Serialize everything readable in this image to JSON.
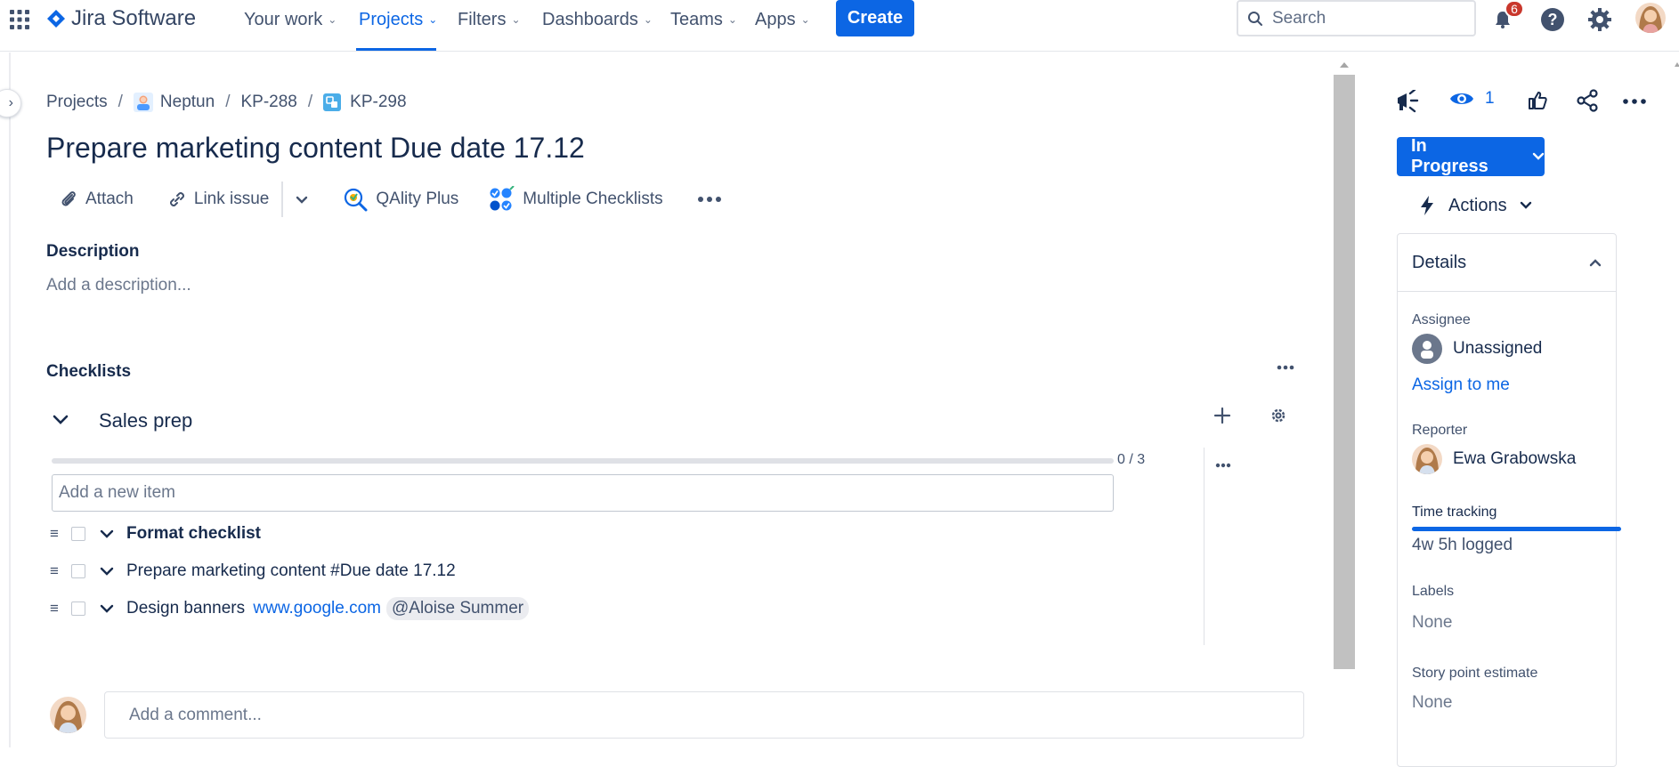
{
  "app": {
    "name": "Jira Software"
  },
  "nav": {
    "your_work": "Your work",
    "projects": "Projects",
    "filters": "Filters",
    "dashboards": "Dashboards",
    "teams": "Teams",
    "apps": "Apps",
    "create": "Create"
  },
  "search": {
    "placeholder": "Search"
  },
  "notifications": {
    "count": "6"
  },
  "breadcrumbs": [
    "Projects",
    "Neptun",
    "KP-288",
    "KP-298"
  ],
  "issue": {
    "title": "Prepare marketing content Due date 17.12"
  },
  "toolbar": {
    "attach": "Attach",
    "link_issue": "Link issue",
    "qality": "QAlity Plus",
    "checklists": "Multiple Checklists"
  },
  "description": {
    "label": "Description",
    "placeholder": "Add a description..."
  },
  "checklists": {
    "label": "Checklists",
    "group": "Sales prep",
    "progress_text": "0 / 3",
    "progress_value": 0,
    "new_item_placeholder": "Add a new item",
    "items": [
      {
        "text": "Format checklist",
        "bold": true
      },
      {
        "text": "Prepare marketing content #Due date 17.12"
      },
      {
        "text": "Design banners ",
        "link": "www.google.com",
        "mention": "@Aloise Summer"
      }
    ]
  },
  "comment": {
    "placeholder": "Add a comment..."
  },
  "side": {
    "watchers": "1",
    "status": "In Progress",
    "actions": "Actions",
    "details_title": "Details",
    "assignee_label": "Assignee",
    "assignee": "Unassigned",
    "assign_to_me": "Assign to me",
    "reporter_label": "Reporter",
    "reporter": "Ewa Grabowska",
    "time_label": "Time tracking",
    "time_logged": "4w 5h logged",
    "labels_label": "Labels",
    "labels": "None",
    "story_label": "Story point estimate",
    "story": "None"
  },
  "colors": {
    "accent": "#0c66e4",
    "text": "#172b4d",
    "subtle": "#42526e",
    "badge": "#c9372c"
  }
}
